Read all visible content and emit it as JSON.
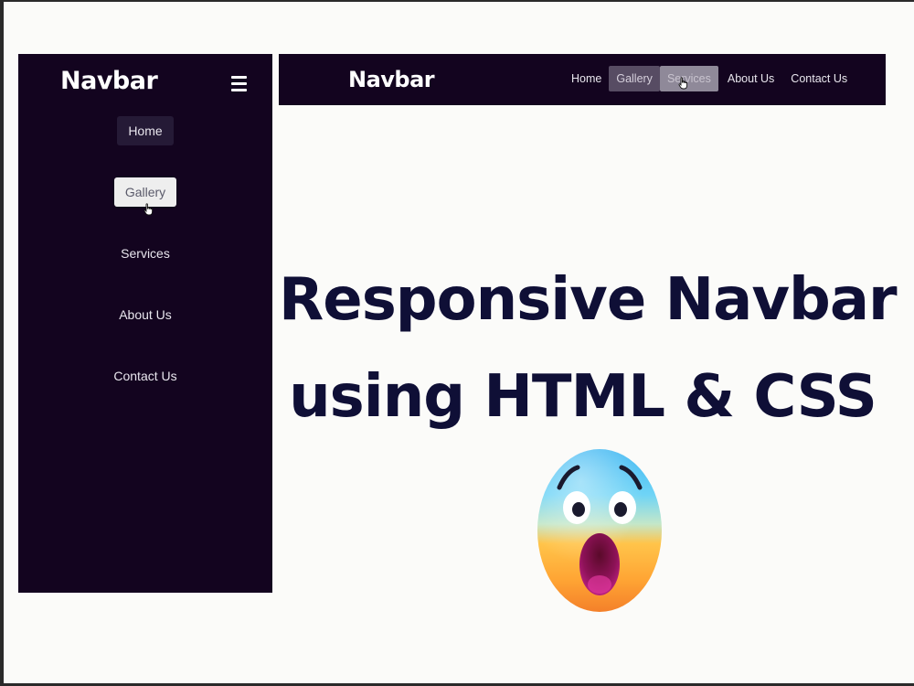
{
  "mobile": {
    "brand": "Navbar",
    "menu_icon": "hamburger-icon",
    "menu": [
      {
        "label": "Home",
        "state": "hover"
      },
      {
        "label": "Gallery",
        "state": "active"
      },
      {
        "label": "Services",
        "state": "default"
      },
      {
        "label": "About Us",
        "state": "default"
      },
      {
        "label": "Contact Us",
        "state": "default"
      }
    ]
  },
  "desktop": {
    "brand": "Navbar",
    "menu": [
      {
        "label": "Home",
        "state": "default"
      },
      {
        "label": "Gallery",
        "state": "hover"
      },
      {
        "label": "Services",
        "state": "active"
      },
      {
        "label": "About Us",
        "state": "default"
      },
      {
        "label": "Contact Us",
        "state": "default"
      }
    ]
  },
  "headline": {
    "line1": "Responsive Navbar",
    "line2": "using HTML & CSS"
  },
  "decorations": {
    "emoji": "screaming-face-emoji",
    "cursor": "hand-pointer-icon"
  },
  "colors": {
    "nav_background": "#13041f",
    "headline_text": "#0f0f36",
    "page_background": "#fbfbf9"
  }
}
